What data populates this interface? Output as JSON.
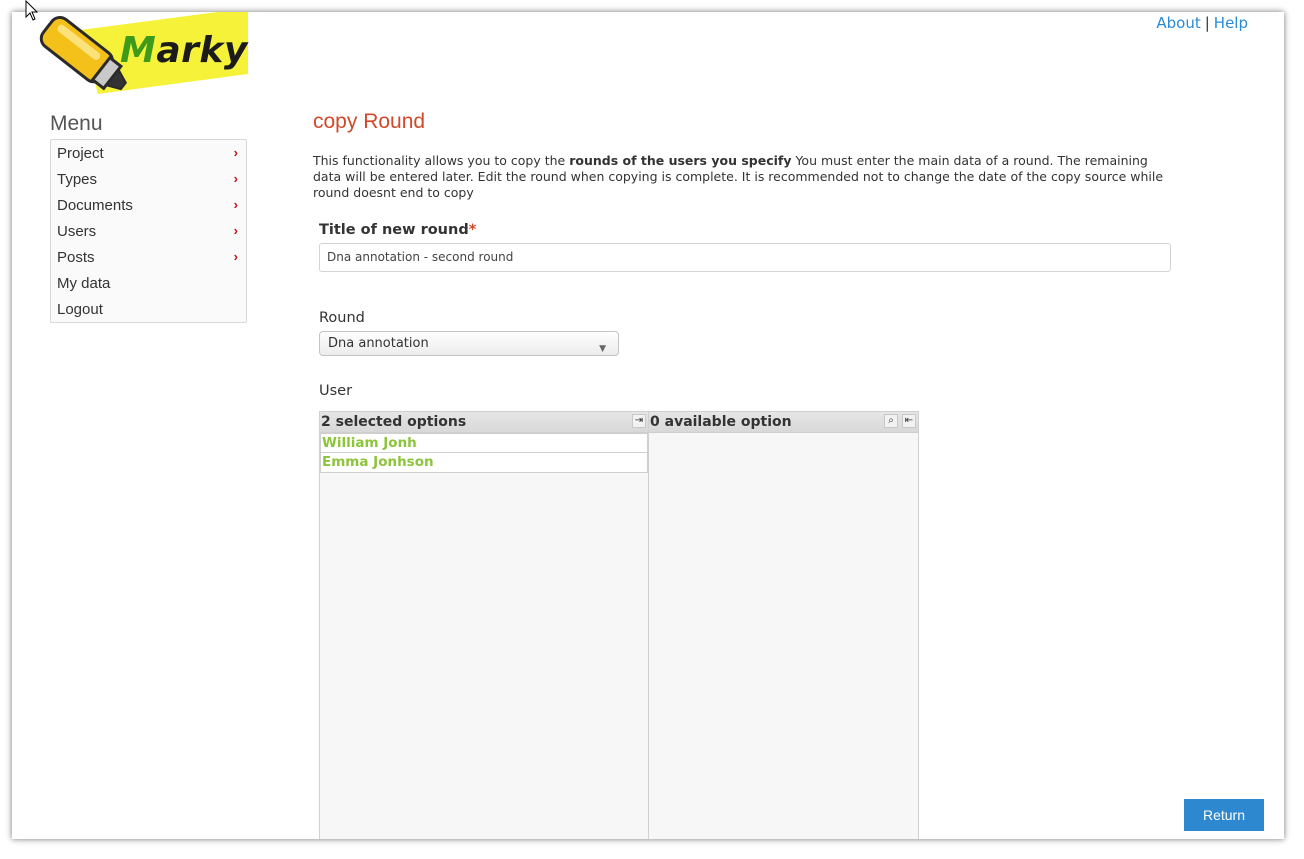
{
  "header": {
    "logo_text_first": "M",
    "logo_text_rest": "arky",
    "about_link": "About",
    "link_separator": "|",
    "help_link": "Help"
  },
  "menu": {
    "title": "Menu",
    "items": [
      {
        "label": "Project",
        "has_submenu": true
      },
      {
        "label": "Types",
        "has_submenu": true
      },
      {
        "label": "Documents",
        "has_submenu": true
      },
      {
        "label": "Users",
        "has_submenu": true
      },
      {
        "label": "Posts",
        "has_submenu": true
      },
      {
        "label": "My data",
        "has_submenu": false
      },
      {
        "label": "Logout",
        "has_submenu": false
      }
    ],
    "chevron_glyph": "›"
  },
  "main": {
    "title": "copy Round",
    "description_before": "This functionality allows you to copy the ",
    "description_bold": "rounds of the users you specify",
    "description_after": " You must enter the main data of a round. The remaining data will be entered later. Edit the round when copying is complete. It is recommended not to change the date of the copy source while round doesnt end to copy",
    "title_field": {
      "label": "Title of new round",
      "required_mark": "*",
      "value": "Dna annotation - second round"
    },
    "round_field": {
      "label": "Round",
      "selected": "Dna annotation"
    },
    "user_field": {
      "label": "User",
      "selected_header": "2 selected options",
      "available_header": "0 available option",
      "selected_items": [
        "William Jonh",
        "Emma Jonhson"
      ],
      "available_items": []
    },
    "return_button": "Return"
  },
  "colors": {
    "accent_blue": "#2d88d0",
    "title_red": "#d2492a",
    "option_green": "#8cc43a",
    "logo_yellow": "#f6f23a"
  }
}
